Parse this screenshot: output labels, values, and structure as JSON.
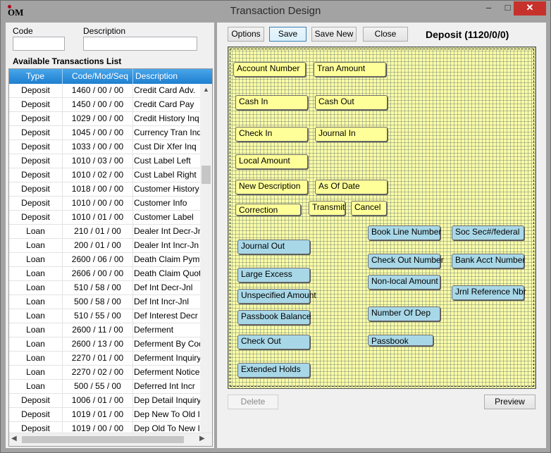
{
  "window": {
    "title": "Transaction Design",
    "logo_text": "OM",
    "minimize_label": "–",
    "maximize_label": "□",
    "close_label": "✕"
  },
  "filters": {
    "code_label": "Code",
    "code_value": "",
    "description_label": "Description",
    "description_value": ""
  },
  "list": {
    "title": "Available Transactions List",
    "columns": [
      "Type",
      "Code/Mod/Seq",
      "Description"
    ],
    "rows": [
      [
        "Deposit",
        "1460 / 00 / 00",
        "Credit Card Adv."
      ],
      [
        "Deposit",
        "1450 / 00 / 00",
        "Credit Card Pay"
      ],
      [
        "Deposit",
        "1029 / 00 / 00",
        "Credit History Inq"
      ],
      [
        "Deposit",
        "1045 / 00 / 00",
        "Currency Tran Inq"
      ],
      [
        "Deposit",
        "1033 / 00 / 00",
        "Cust Dir Xfer Inq"
      ],
      [
        "Deposit",
        "1010 / 03 / 00",
        "Cust Label Left"
      ],
      [
        "Deposit",
        "1010 / 02 / 00",
        "Cust Label Right"
      ],
      [
        "Deposit",
        "1018 / 00 / 00",
        "Customer History"
      ],
      [
        "Deposit",
        "1010 / 00 / 00",
        "Customer Info"
      ],
      [
        "Deposit",
        "1010 / 01 / 00",
        "Customer Label"
      ],
      [
        "Loan",
        "210 / 01 / 00",
        "Dealer Int Decr-Jn"
      ],
      [
        "Loan",
        "200 / 01 / 00",
        "Dealer Int Incr-Jn"
      ],
      [
        "Loan",
        "2600 / 06 / 00",
        "Death Claim Pymt"
      ],
      [
        "Loan",
        "2606 / 00 / 00",
        "Death Claim Quote"
      ],
      [
        "Loan",
        "510 / 58 / 00",
        "Def Int Decr-Jnl"
      ],
      [
        "Loan",
        "500 / 58 / 00",
        "Def Int Incr-Jnl"
      ],
      [
        "Loan",
        "510 / 55 / 00",
        "Def Interest Decr"
      ],
      [
        "Loan",
        "2600 / 11 / 00",
        "Deferment"
      ],
      [
        "Loan",
        "2600 / 13 / 00",
        "Deferment By Code"
      ],
      [
        "Loan",
        "2270 / 01 / 00",
        "Deferment Inquiry"
      ],
      [
        "Loan",
        "2270 / 02 / 00",
        "Deferment Notice"
      ],
      [
        "Loan",
        "500 / 55 / 00",
        "Deferred Int Incr"
      ],
      [
        "Deposit",
        "1006 / 01 / 00",
        "Dep Detail Inquiry"
      ],
      [
        "Deposit",
        "1019 / 01 / 00",
        "Dep New To Old In"
      ],
      [
        "Deposit",
        "1019 / 00 / 00",
        "Dep Old To New In"
      ]
    ]
  },
  "toolbar": {
    "options": "Options",
    "save": "Save",
    "save_new": "Save New",
    "close": "Close",
    "heading": "Deposit (1120/0/0)"
  },
  "fields": {
    "yellow": [
      "Account Number",
      "Tran Amount",
      "Cash In",
      "Cash Out",
      "Check In",
      "Journal In",
      "Local Amount",
      "New Description",
      "As Of Date",
      "Correction",
      "Transmit",
      "Cancel"
    ],
    "blue": [
      "Book Line Number",
      "Soc Sec#/federal",
      "Journal Out",
      "Check Out Number",
      "Bank Acct Number",
      "Large Excess",
      "Non-local Amount",
      "Unspecified Amount",
      "Jrnl Reference Nbr",
      "Passbook Balance",
      "Number Of Dep",
      "Check Out",
      "Passbook",
      "Extended Holds"
    ]
  },
  "footer": {
    "delete": "Delete",
    "preview": "Preview"
  },
  "colors": {
    "field_yellow": "#ffff99",
    "field_blue": "#a8d8e8",
    "canvas": "#fffea8",
    "header_blue": "#1e7fd0",
    "close_red": "#c7312c"
  }
}
